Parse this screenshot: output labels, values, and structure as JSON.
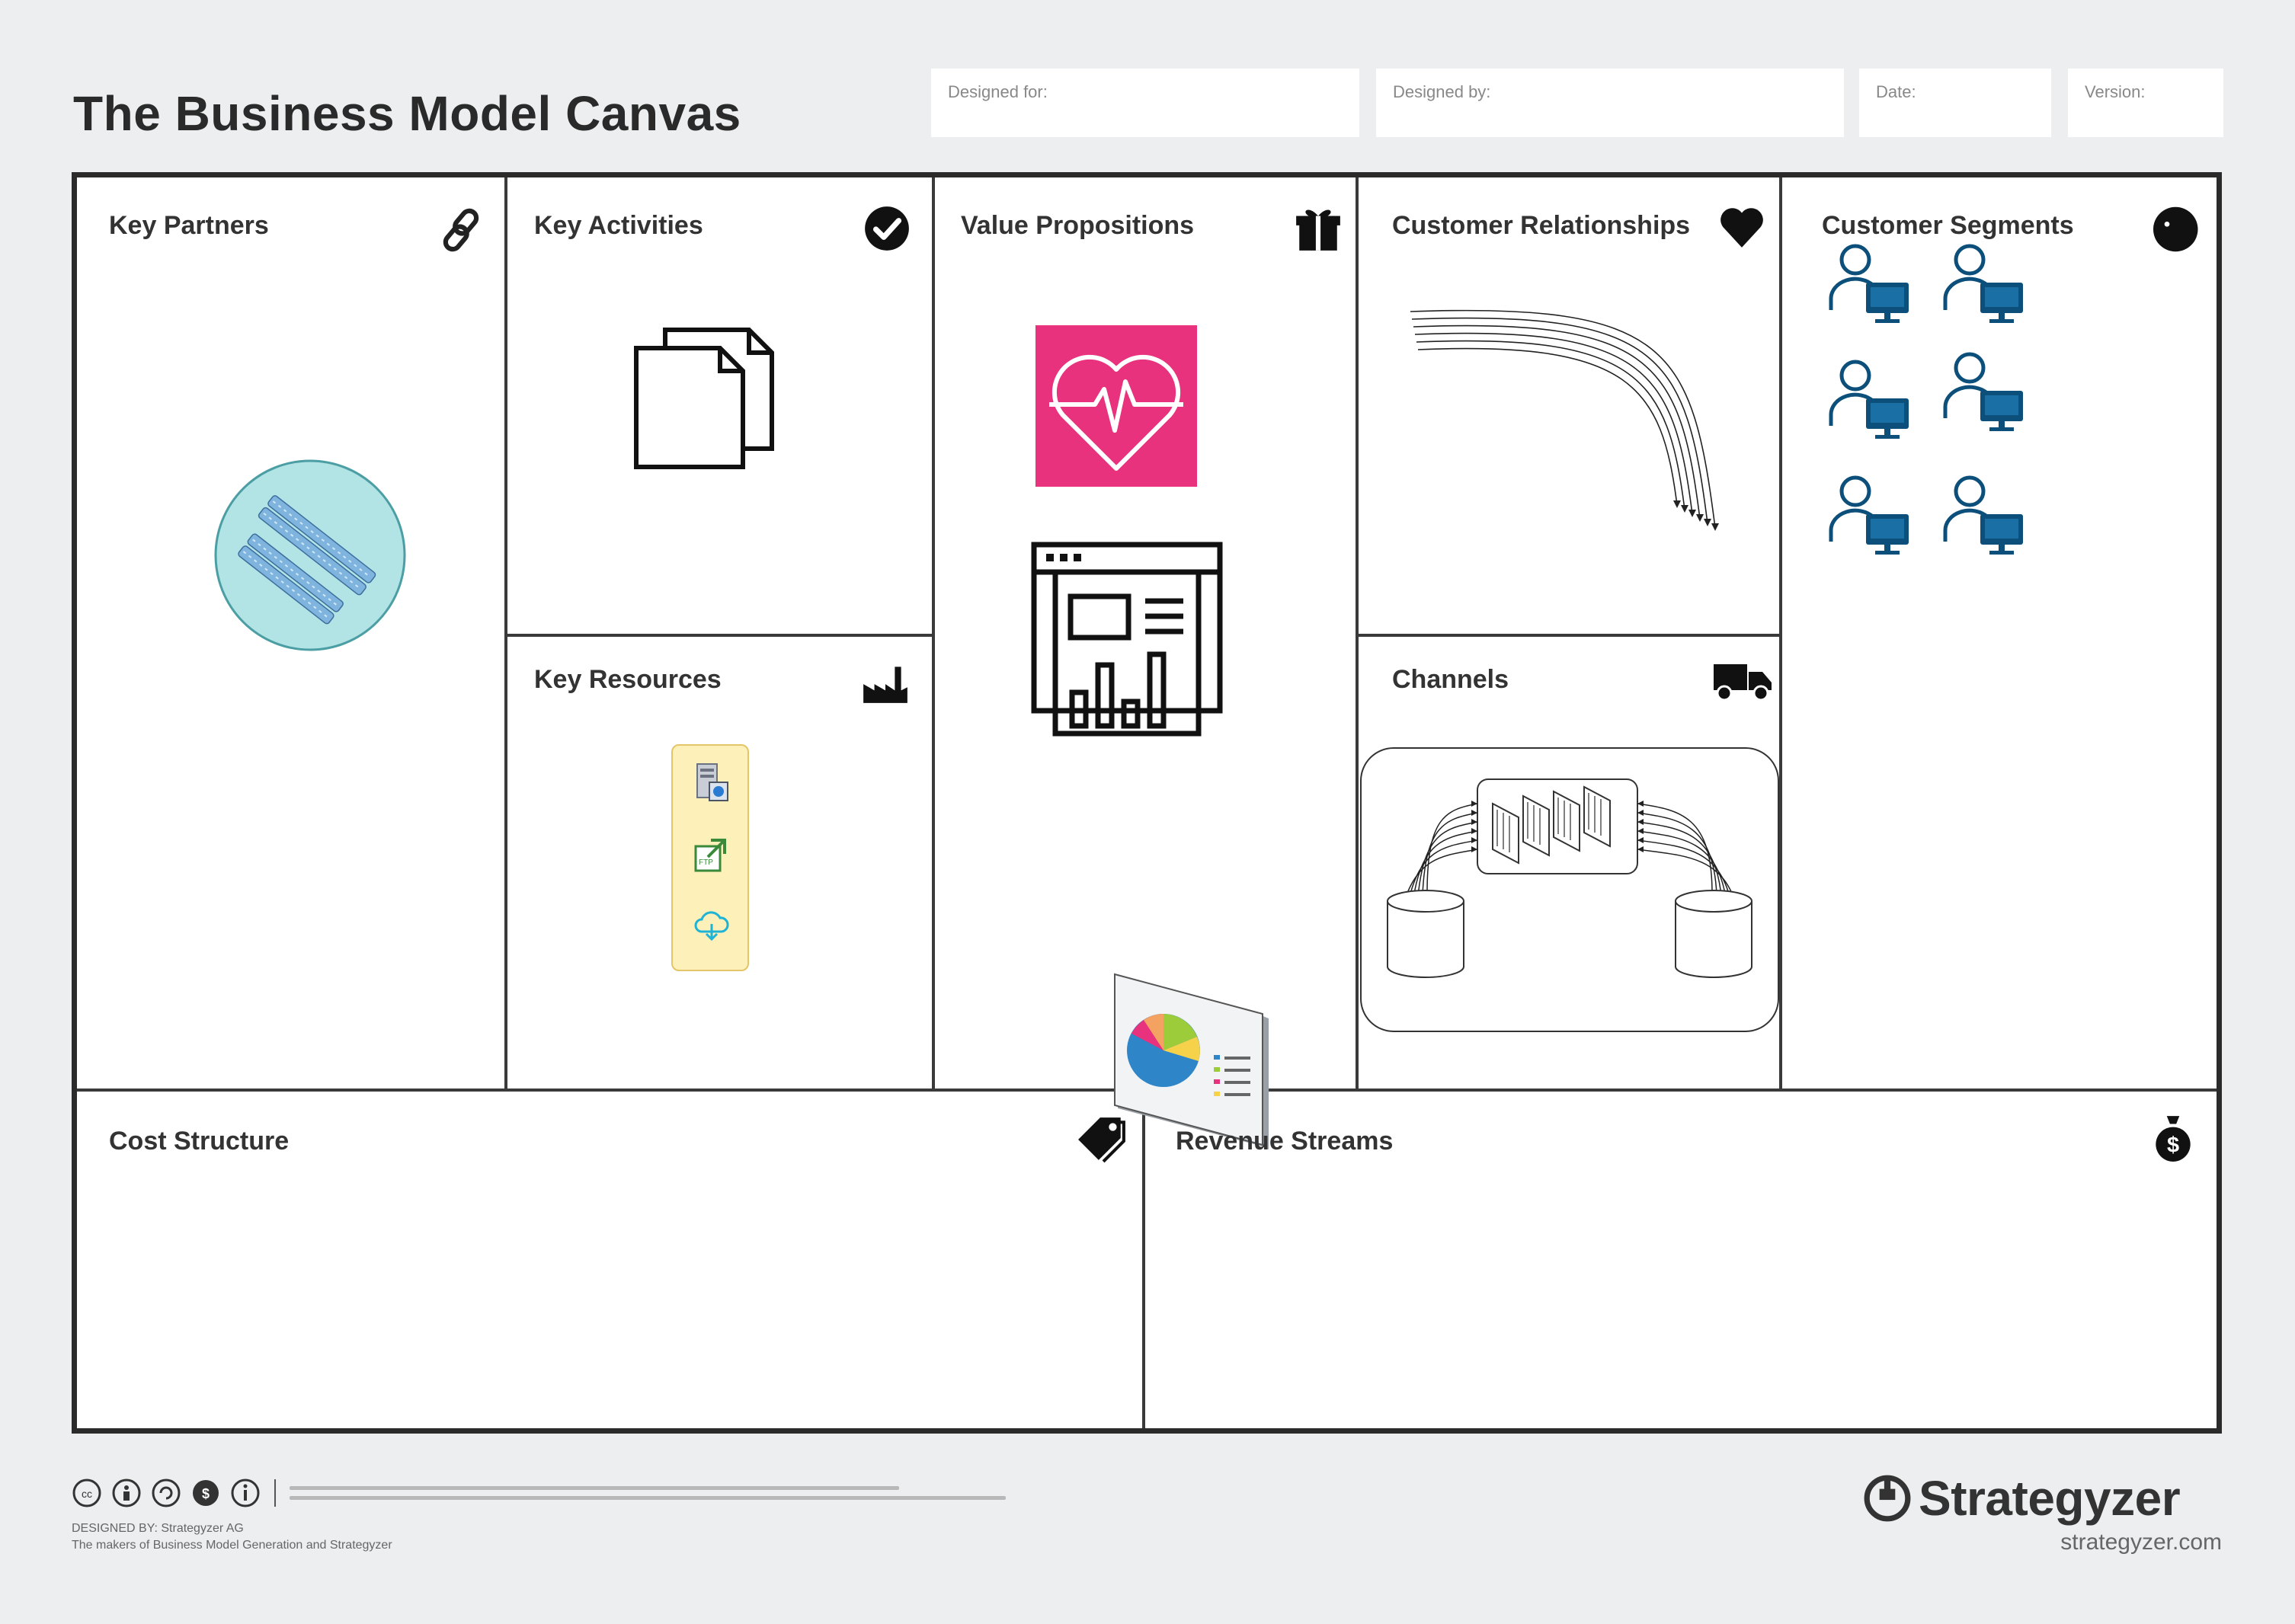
{
  "header": {
    "title": "The Business Model Canvas",
    "designed_for_label": "Designed for:",
    "designed_by_label": "Designed by:",
    "date_label": "Date:",
    "version_label": "Version:"
  },
  "blocks": {
    "key_partners": {
      "title": "Key Partners",
      "icon": "link-icon"
    },
    "key_activities": {
      "title": "Key Activities",
      "icon": "check-circle-icon"
    },
    "key_resources": {
      "title": "Key Resources",
      "icon": "factory-icon"
    },
    "value_propositions": {
      "title": "Value Propositions",
      "icon": "gift-icon"
    },
    "customer_relationships": {
      "title": "Customer Relationships",
      "icon": "heart-icon"
    },
    "channels": {
      "title": "Channels",
      "icon": "truck-icon"
    },
    "customer_segments": {
      "title": "Customer Segments",
      "icon": "face-icon"
    },
    "cost_structure": {
      "title": "Cost Structure",
      "icon": "price-tag-icon"
    },
    "revenue_streams": {
      "title": "Revenue Streams",
      "icon": "money-bag-icon"
    }
  },
  "colors": {
    "background": "#eceeef",
    "partners_circle": "#b2e3e5",
    "health_tile": "#e8327d",
    "resource_box": "#fdf0b8",
    "user_blue": "#0b4f7a"
  },
  "footer": {
    "designed_by": "DESIGNED BY: Strategyzer AG",
    "more_info": "The makers of Business Model Generation and Strategyzer",
    "brand": "Strategyzer",
    "brand_url": "strategyzer.com"
  }
}
